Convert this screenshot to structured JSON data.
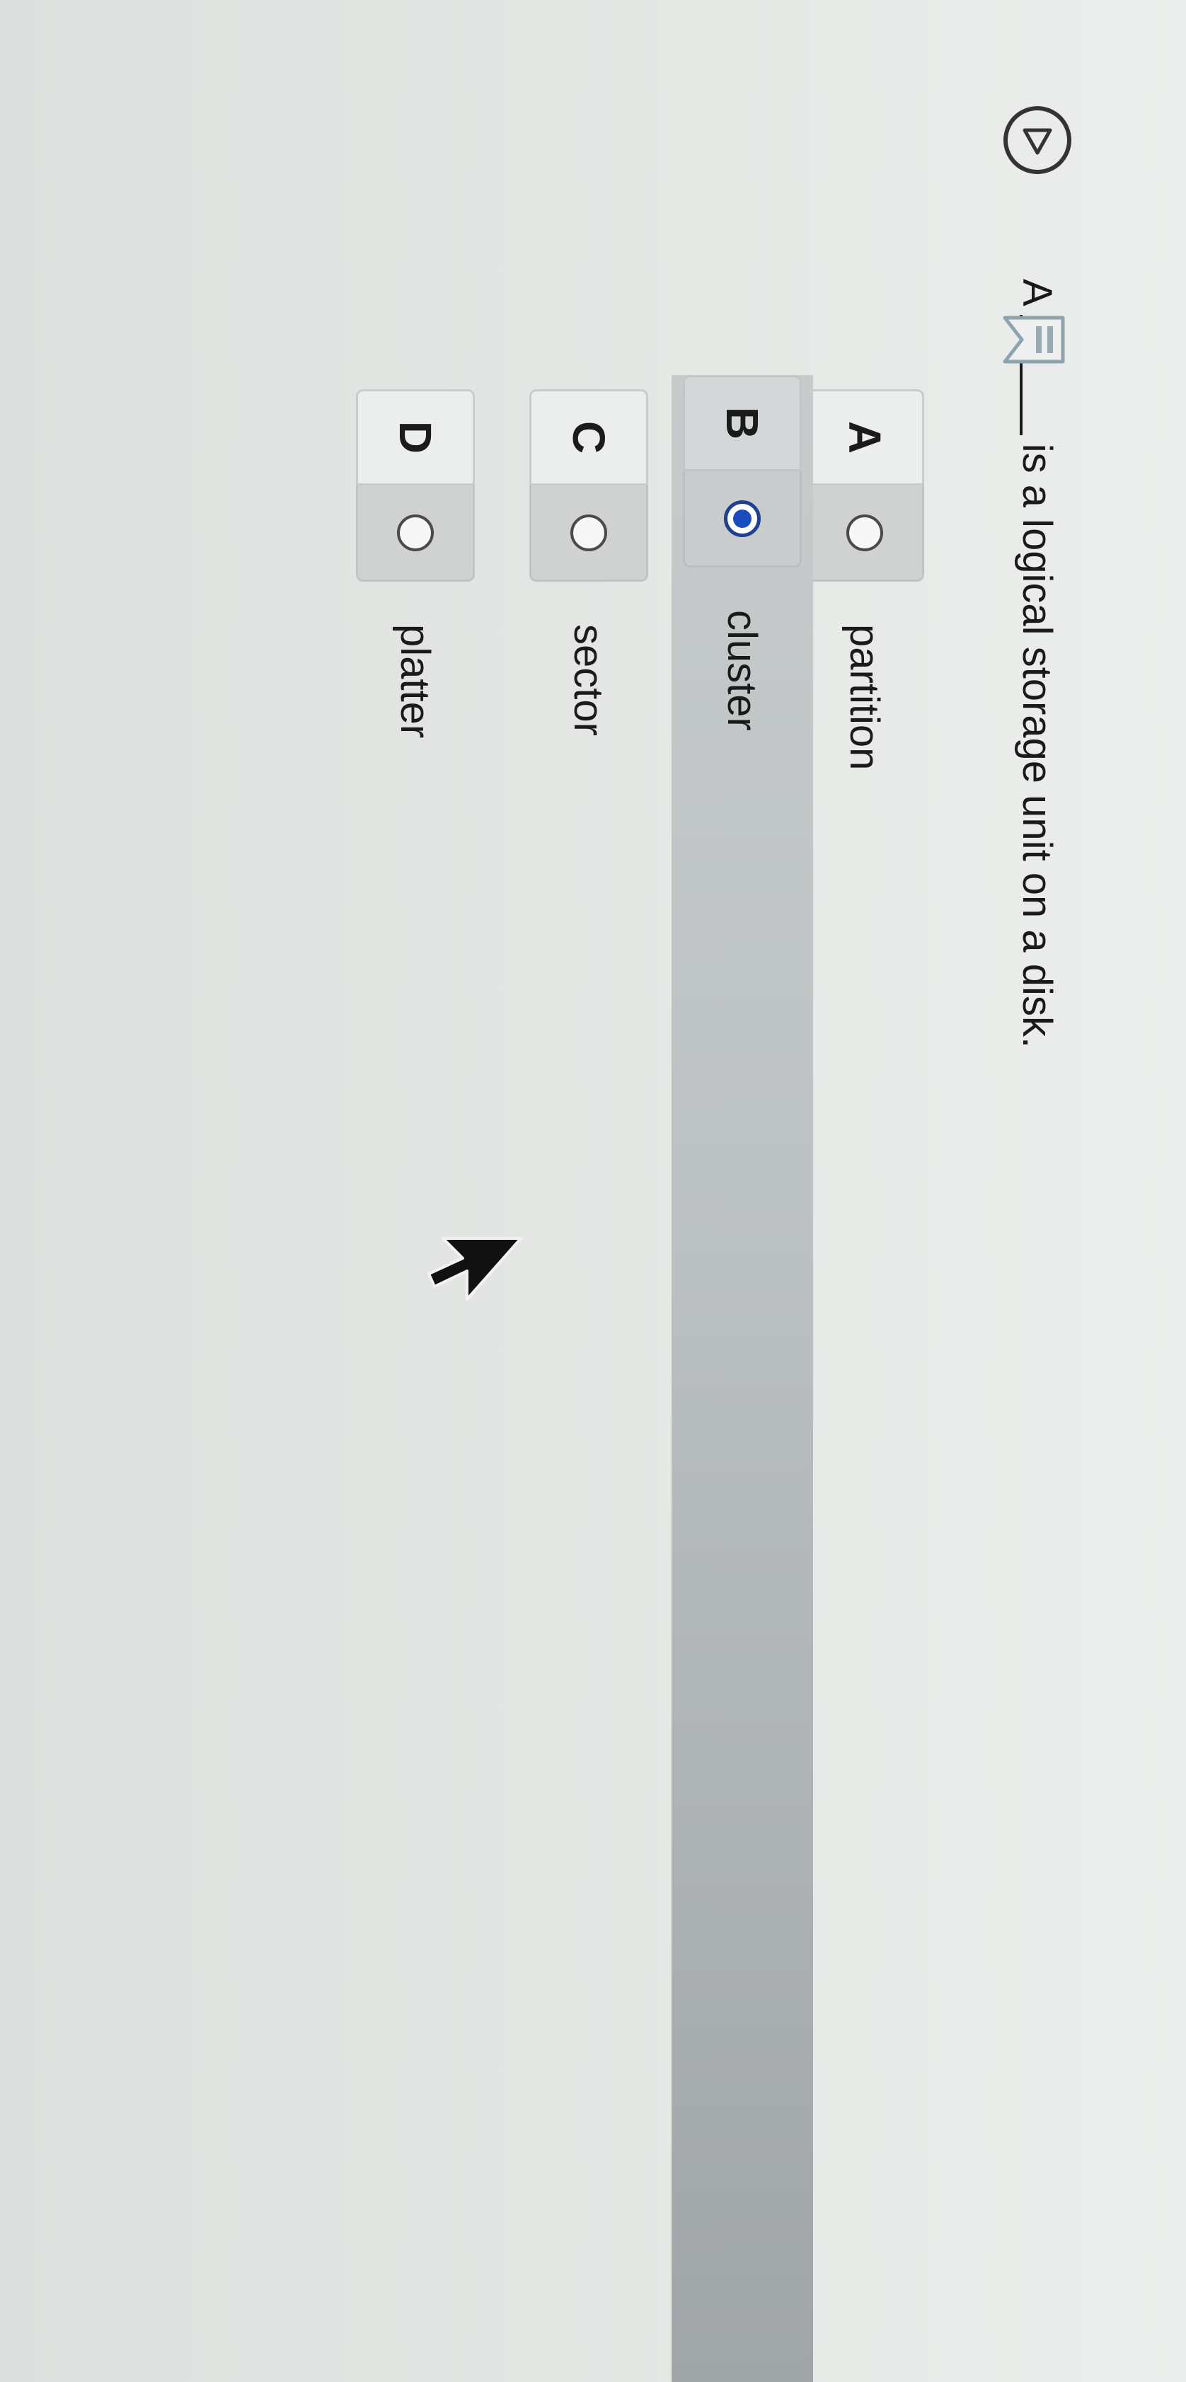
{
  "question": {
    "prefix": "A",
    "text": "is a logical storage unit on a disk."
  },
  "choices": [
    {
      "letter": "A",
      "label": "partition",
      "selected": false
    },
    {
      "letter": "B",
      "label": "cluster",
      "selected": true
    },
    {
      "letter": "C",
      "label": "sector",
      "selected": false
    },
    {
      "letter": "D",
      "label": "platter",
      "selected": false
    }
  ],
  "icons": {
    "play": "play-triangle-icon",
    "bookmark": "bookmark-icon",
    "cursor": "mouse-pointer-icon"
  },
  "colors": {
    "selected_radio": "#1a4bbf",
    "highlight_row": "#bcc1c3"
  }
}
